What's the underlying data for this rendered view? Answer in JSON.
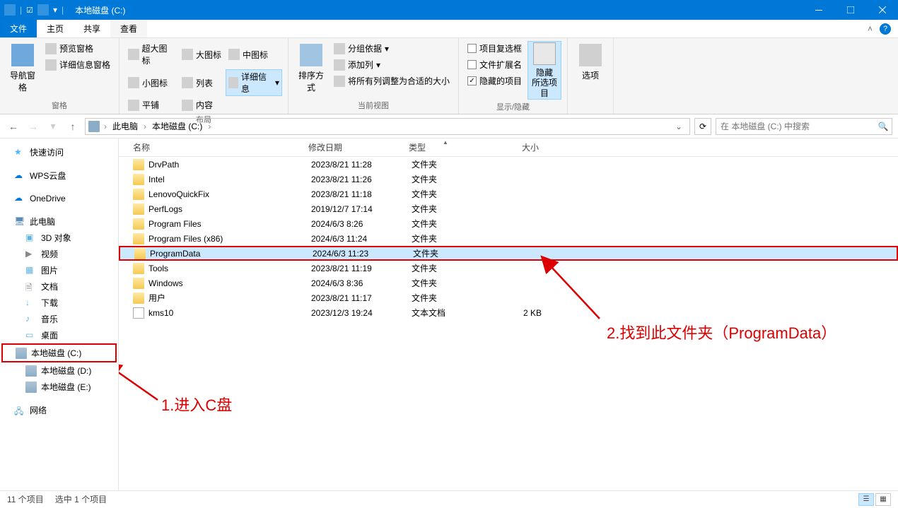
{
  "titlebar": {
    "title": "本地磁盘 (C:)"
  },
  "tabs": {
    "file": "文件",
    "home": "主页",
    "share": "共享",
    "view": "查看"
  },
  "ribbon": {
    "panes": {
      "nav_pane": "导航窗格",
      "preview_pane": "预览窗格",
      "details_pane": "详细信息窗格",
      "label": "窗格"
    },
    "layout": {
      "xl_icons": "超大图标",
      "l_icons": "大图标",
      "m_icons": "中图标",
      "s_icons": "小图标",
      "list": "列表",
      "details": "详细信息",
      "tiles": "平铺",
      "content": "内容",
      "label": "布局"
    },
    "current_view": {
      "sort_by": "排序方式",
      "group_by": "分组依据",
      "add_columns": "添加列",
      "size_all": "将所有列调整为合适的大小",
      "label": "当前视图"
    },
    "show_hide": {
      "item_check": "项目复选框",
      "file_ext": "文件扩展名",
      "hidden_items": "隐藏的项目",
      "hidden_checked": true,
      "hide_selected": "隐藏\n所选项目",
      "label": "显示/隐藏"
    },
    "options": {
      "options": "选项"
    }
  },
  "breadcrumb": {
    "this_pc": "此电脑",
    "drive": "本地磁盘 (C:)"
  },
  "search": {
    "placeholder": "在 本地磁盘 (C:) 中搜索"
  },
  "sidebar": {
    "quick_access": "快速访问",
    "wps_cloud": "WPS云盘",
    "onedrive": "OneDrive",
    "this_pc": "此电脑",
    "objects_3d": "3D 对象",
    "videos": "视频",
    "pictures": "图片",
    "documents": "文档",
    "downloads": "下载",
    "music": "音乐",
    "desktop": "桌面",
    "drive_c": "本地磁盘 (C:)",
    "drive_d": "本地磁盘 (D:)",
    "drive_e": "本地磁盘 (E:)",
    "network": "网络"
  },
  "columns": {
    "name": "名称",
    "date": "修改日期",
    "type": "类型",
    "size": "大小"
  },
  "type_folder": "文件夹",
  "type_text": "文本文档",
  "files": [
    {
      "name": "DrvPath",
      "date": "2023/8/21 11:28",
      "type": "文件夹",
      "size": "",
      "icon": "folder"
    },
    {
      "name": "Intel",
      "date": "2023/8/21 11:26",
      "type": "文件夹",
      "size": "",
      "icon": "folder"
    },
    {
      "name": "LenovoQuickFix",
      "date": "2023/8/21 11:18",
      "type": "文件夹",
      "size": "",
      "icon": "folder"
    },
    {
      "name": "PerfLogs",
      "date": "2019/12/7 17:14",
      "type": "文件夹",
      "size": "",
      "icon": "folder"
    },
    {
      "name": "Program Files",
      "date": "2024/6/3 8:26",
      "type": "文件夹",
      "size": "",
      "icon": "folder"
    },
    {
      "name": "Program Files (x86)",
      "date": "2024/6/3 11:24",
      "type": "文件夹",
      "size": "",
      "icon": "folder"
    },
    {
      "name": "ProgramData",
      "date": "2024/6/3 11:23",
      "type": "文件夹",
      "size": "",
      "icon": "folder",
      "selected": true
    },
    {
      "name": "Tools",
      "date": "2023/8/21 11:19",
      "type": "文件夹",
      "size": "",
      "icon": "folder"
    },
    {
      "name": "Windows",
      "date": "2024/6/3 8:36",
      "type": "文件夹",
      "size": "",
      "icon": "folder"
    },
    {
      "name": "用户",
      "date": "2023/8/21 11:17",
      "type": "文件夹",
      "size": "",
      "icon": "folder"
    },
    {
      "name": "kms10",
      "date": "2023/12/3 19:24",
      "type": "文本文档",
      "size": "2 KB",
      "icon": "text"
    }
  ],
  "status": {
    "items": "11 个项目",
    "selected": "选中 1 个项目"
  },
  "annotations": {
    "a1": "1.进入C盘",
    "a2": "2.找到此文件夹（ProgramData）"
  }
}
